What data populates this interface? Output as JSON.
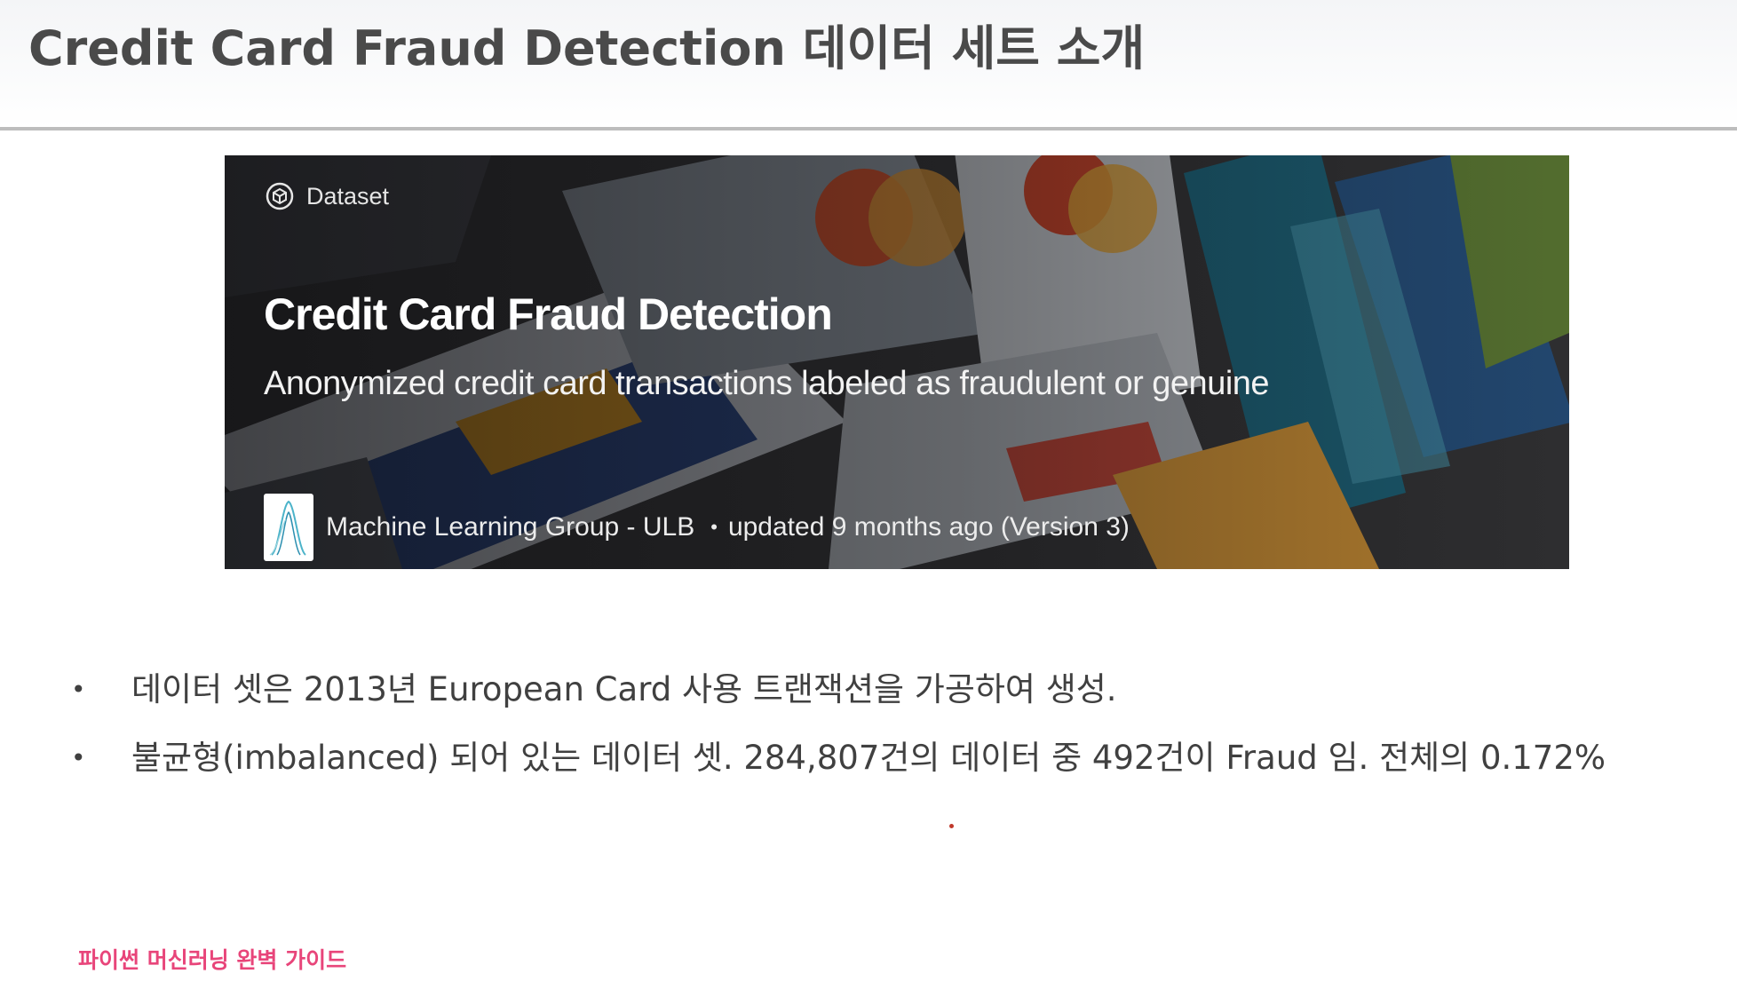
{
  "slide": {
    "title": "Credit Card Fraud Detection 데이터 세트 소개"
  },
  "banner": {
    "tag": "Dataset",
    "title": "Credit Card Fraud Detection",
    "subtitle": "Anonymized credit card transactions labeled as fraudulent or genuine",
    "organization": "Machine Learning Group - ULB",
    "separator": "•",
    "updated": "updated 9 months ago (Version 3)",
    "icons": {
      "tag_icon": "dataset-icon",
      "org_logo": "ulb-logo"
    }
  },
  "bullets": [
    {
      "marker": "•",
      "text": "데이터 셋은 2013년 European Card 사용 트랜잭션을 가공하여 생성."
    },
    {
      "marker": "•",
      "text": "불균형(imbalanced) 되어 있는 데이터 셋. 284,807건의 데이터 중 492건이 Fraud 임. 전체의 0.172%"
    }
  ],
  "footer": {
    "text": "파이썬 머신러닝 완벽 가이드"
  },
  "colors": {
    "title": "#4a4a4a",
    "body": "#404040",
    "footer": "#e8457a"
  }
}
